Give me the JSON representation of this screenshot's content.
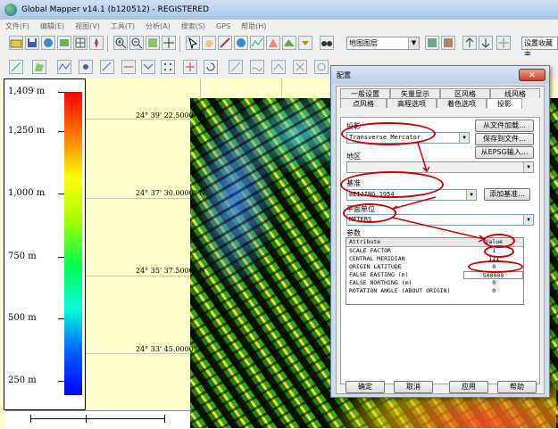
{
  "app": {
    "title": "Global Mapper v14.1 (b120512) - REGISTERED"
  },
  "menu": [
    "文件(F)",
    "编辑(E)",
    "视图(V)",
    "工具(T)",
    "分析(A)",
    "搜索(S)",
    "GPS",
    "帮助(H)"
  ],
  "toolbar": {
    "layer_combo": "地图图层",
    "settings_combo": "设置收藏夹"
  },
  "legend": {
    "labels": [
      "1,409 m",
      "1,250 m",
      "1,000 m",
      "750 m",
      "500 m",
      "250 m"
    ],
    "colors": [
      "#ff0000",
      "#ffff00",
      "#00ff50",
      "#0000ff"
    ]
  },
  "map": {
    "lat_labels": [
      "24° 39' 22.5000\" N",
      "24° 37' 30.0000\" N",
      "24° 35' 37.5000\" N",
      "24° 33' 45.0000\" N"
    ]
  },
  "dialog": {
    "title": "配置",
    "tabs_row1": [
      "一般设置",
      "矢量显示",
      "区风格",
      "线风格"
    ],
    "tabs_row2": [
      "点风格",
      "高程选项",
      "着色选项",
      "投影"
    ],
    "projection_label": "投影",
    "projection_value": "Transverse Mercator",
    "load_from_file": "从文件加载...",
    "save_to_file": "保存到文件...",
    "epsg_input": "从EPSG输入...",
    "zone_label": "地区",
    "zone_value": "",
    "datum_label": "基准",
    "datum_value": "BEIJING 1954",
    "add_datum": "添加基准...",
    "units_label": "平面单位",
    "units_value": "METERS",
    "params_label": "参数",
    "table": {
      "headers": [
        "Attribute",
        "Value"
      ],
      "rows": [
        [
          "SCALE FACTOR",
          "1"
        ],
        [
          "CENTRAL MERIDIAN",
          "111"
        ],
        [
          "ORIGIN LATITUDE",
          "0"
        ],
        [
          "FALSE EASTING (m)",
          "500000"
        ],
        [
          "FALSE NORTHING (m)",
          "0"
        ],
        [
          "ROTATION ANGLE (ABOUT ORIGIN)",
          "0"
        ]
      ]
    },
    "buttons": [
      "确定",
      "取消",
      "应用",
      "帮助"
    ]
  },
  "colors": {
    "annotation": "#d00000",
    "titlebar": "#bcd0ea"
  }
}
